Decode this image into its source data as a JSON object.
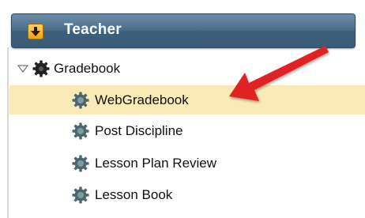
{
  "header": {
    "title": "Teacher",
    "collapse_icon": "download-arrow-icon"
  },
  "tree": {
    "root": {
      "label": "Gradebook",
      "expanded": true
    },
    "items": [
      {
        "label": "WebGradebook",
        "selected": true
      },
      {
        "label": "Post Discipline"
      },
      {
        "label": "Lesson Plan Review"
      },
      {
        "label": "Lesson Book"
      }
    ]
  },
  "annotation": {
    "type": "red-arrow",
    "color": "#e02020"
  }
}
